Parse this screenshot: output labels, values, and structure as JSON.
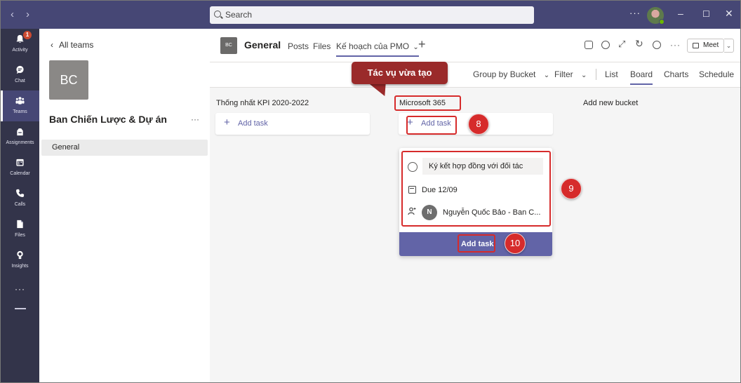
{
  "titlebar": {
    "back_icon": "chevron-left-icon",
    "forward_icon": "chevron-right-icon",
    "search_placeholder": "Search",
    "more_icon": "ellipsis-icon",
    "minimize_icon": "minimize-icon",
    "maximize_icon": "maximize-icon",
    "close_icon": "close-icon",
    "bar_color": "#464775"
  },
  "rail": {
    "items": [
      {
        "label": "Activity",
        "icon": "bell-icon",
        "badge": "1"
      },
      {
        "label": "Chat",
        "icon": "chat-icon"
      },
      {
        "label": "Teams",
        "icon": "teams-icon",
        "active": true
      },
      {
        "label": "Assignments",
        "icon": "backpack-icon"
      },
      {
        "label": "Calendar",
        "icon": "calendar-icon"
      },
      {
        "label": "Calls",
        "icon": "phone-icon"
      },
      {
        "label": "Files",
        "icon": "file-icon"
      },
      {
        "label": "Insights",
        "icon": "lightbulb-icon"
      }
    ],
    "more_label": "···"
  },
  "sidebar": {
    "all_teams": "All teams",
    "team_initials": "BC",
    "team_name": "Ban Chiến Lược & Dự án",
    "team_more": "···",
    "channels": [
      "General"
    ]
  },
  "header": {
    "channel_initials": "BC",
    "channel_name": "General",
    "tabs": [
      "Posts",
      "Files",
      "Kế hoạch của PMO"
    ],
    "tab_dropdown": "⌄",
    "add_tab": "+",
    "meet_label": "Meet",
    "meet_dropdown": "⌄",
    "more": "···"
  },
  "toolbar": {
    "group_by": "Group by Bucket",
    "filter": "Filter",
    "views": [
      "List",
      "Board",
      "Charts",
      "Schedule"
    ],
    "active_view": "Board",
    "dropdown": "⌄"
  },
  "board": {
    "buckets": [
      {
        "title": "Thống nhất KPI 2020-2022",
        "add_task": "Add task"
      },
      {
        "title": "Microsoft 365",
        "add_task": "Add task"
      }
    ],
    "add_new_bucket": "Add new bucket",
    "new_task": {
      "title": "Ký kết hợp đồng với đối tác",
      "due": "Due 12/09",
      "assignee_initial": "N",
      "assignee": "Nguyễn Quốc Bảo - Ban C...",
      "submit": "Add task"
    }
  },
  "annotations": {
    "callout": "Tác vụ vừa tạo",
    "steps": [
      "8",
      "9",
      "10"
    ],
    "accent_color": "#d62b2b"
  },
  "accent": "#6264a7"
}
